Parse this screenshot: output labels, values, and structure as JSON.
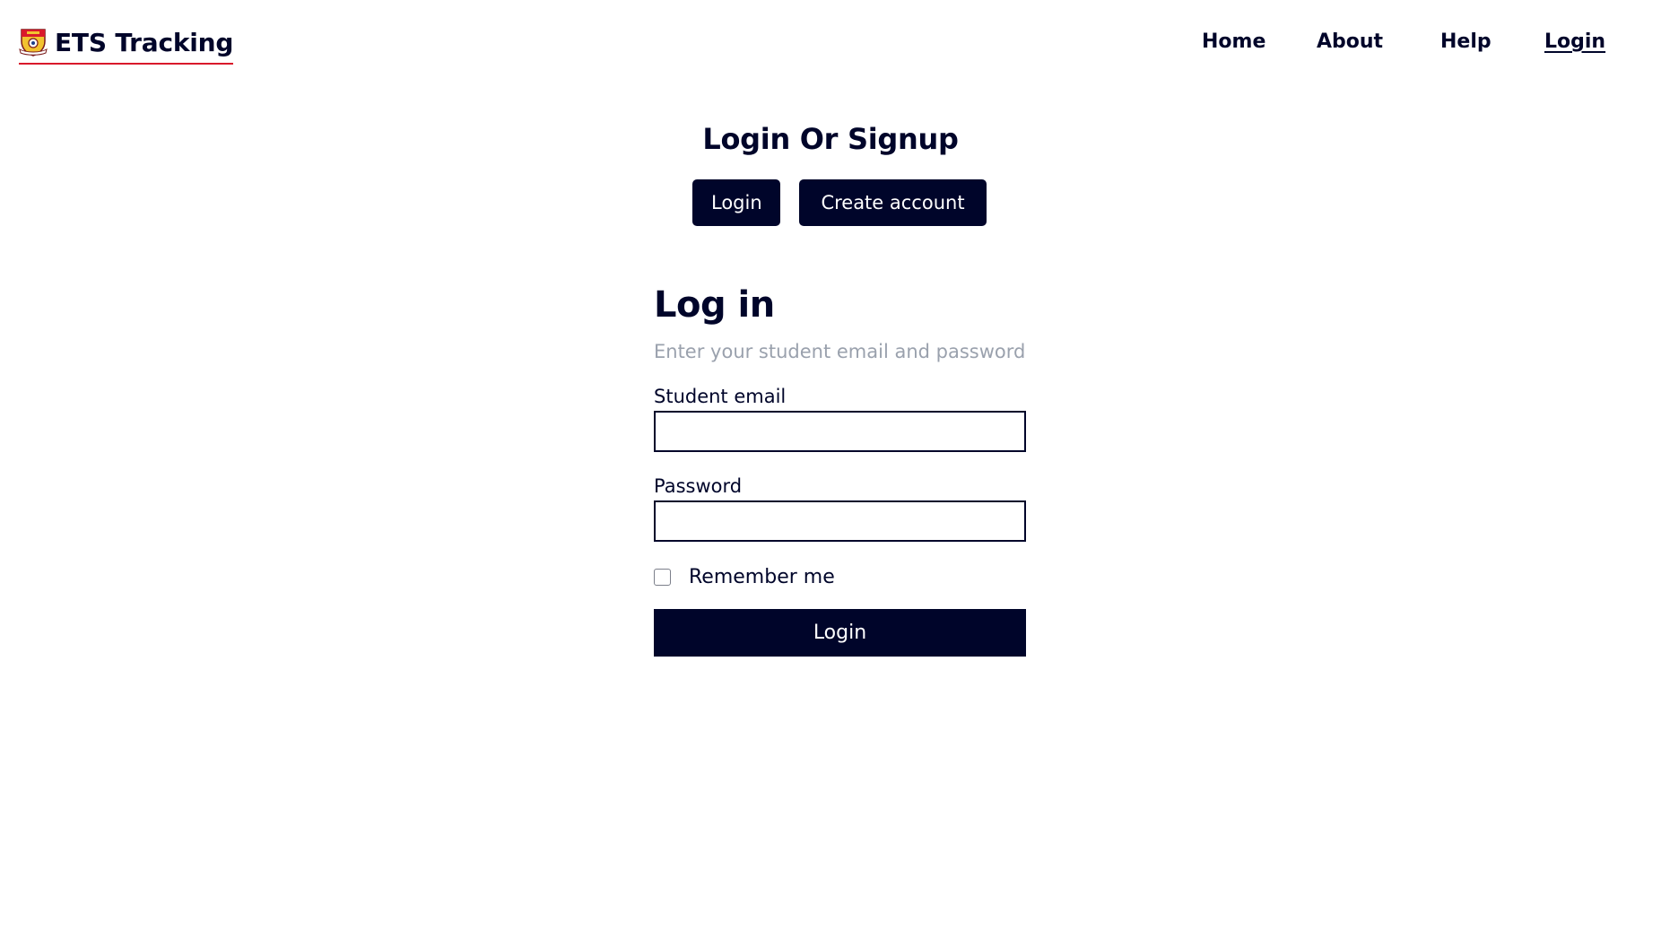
{
  "header": {
    "brand_name": "ETS Tracking",
    "logo_icon": "crest-logo-icon",
    "nav": {
      "home": "Home",
      "about": "About",
      "help": "Help",
      "login": "Login"
    }
  },
  "switcher": {
    "title": "Login Or Signup",
    "login_label": "Login",
    "create_label": "Create account"
  },
  "login_form": {
    "title": "Log in",
    "subtitle": "Enter your student email and password",
    "email_label": "Student email",
    "email_value": "",
    "password_label": "Password",
    "password_value": "",
    "remember_label": "Remember me",
    "remember_checked": false,
    "submit_label": "Login"
  },
  "colors": {
    "primary": "#00052a",
    "accent_underline": "#d9192b",
    "muted_text": "#9aa1ad",
    "background": "#ffffff"
  }
}
